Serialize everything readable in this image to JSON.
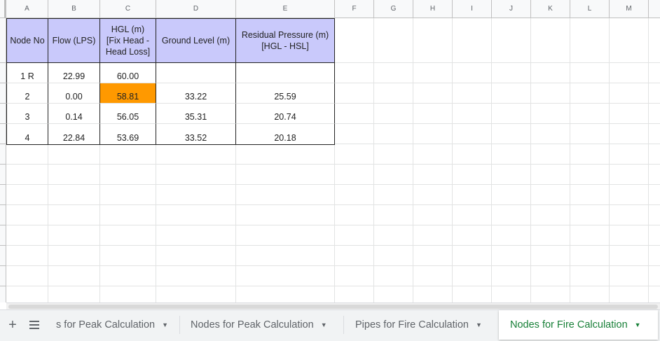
{
  "columns": [
    "A",
    "B",
    "C",
    "D",
    "E",
    "F",
    "G",
    "H",
    "I",
    "J",
    "K",
    "L",
    "M"
  ],
  "table": {
    "headers": [
      "Node No",
      "Flow (LPS)",
      "HGL (m)\n[Fix Head -\nHead Loss]",
      "Ground Level (m)",
      "Residual Pressure (m)\n[HGL - HSL]"
    ],
    "rows": [
      [
        "1 R",
        "22.99",
        "60.00",
        "",
        ""
      ],
      [
        "2",
        "0.00",
        "58.81",
        "33.22",
        "25.59"
      ],
      [
        "3",
        "0.14",
        "56.05",
        "35.31",
        "20.74"
      ],
      [
        "4",
        "22.84",
        "53.69",
        "33.52",
        "20.18"
      ]
    ],
    "highlight_color": "#ff9900",
    "header_color": "#c9c9fb"
  },
  "sheet_tabs": [
    {
      "label": "Nodes for Peak Calculation",
      "visible_label": "s for Peak Calculation",
      "active": false
    },
    {
      "label": "Nodes for Peak Calculation",
      "active": false
    },
    {
      "label": "Pipes for Fire Calculation",
      "active": false
    },
    {
      "label": "Nodes for Fire Calculation",
      "active": true
    }
  ],
  "icons": {
    "add_sheet": "plus-icon",
    "all_sheets": "list-icon",
    "tab_menu": "caret-down-icon"
  },
  "accent_color": "#188038"
}
